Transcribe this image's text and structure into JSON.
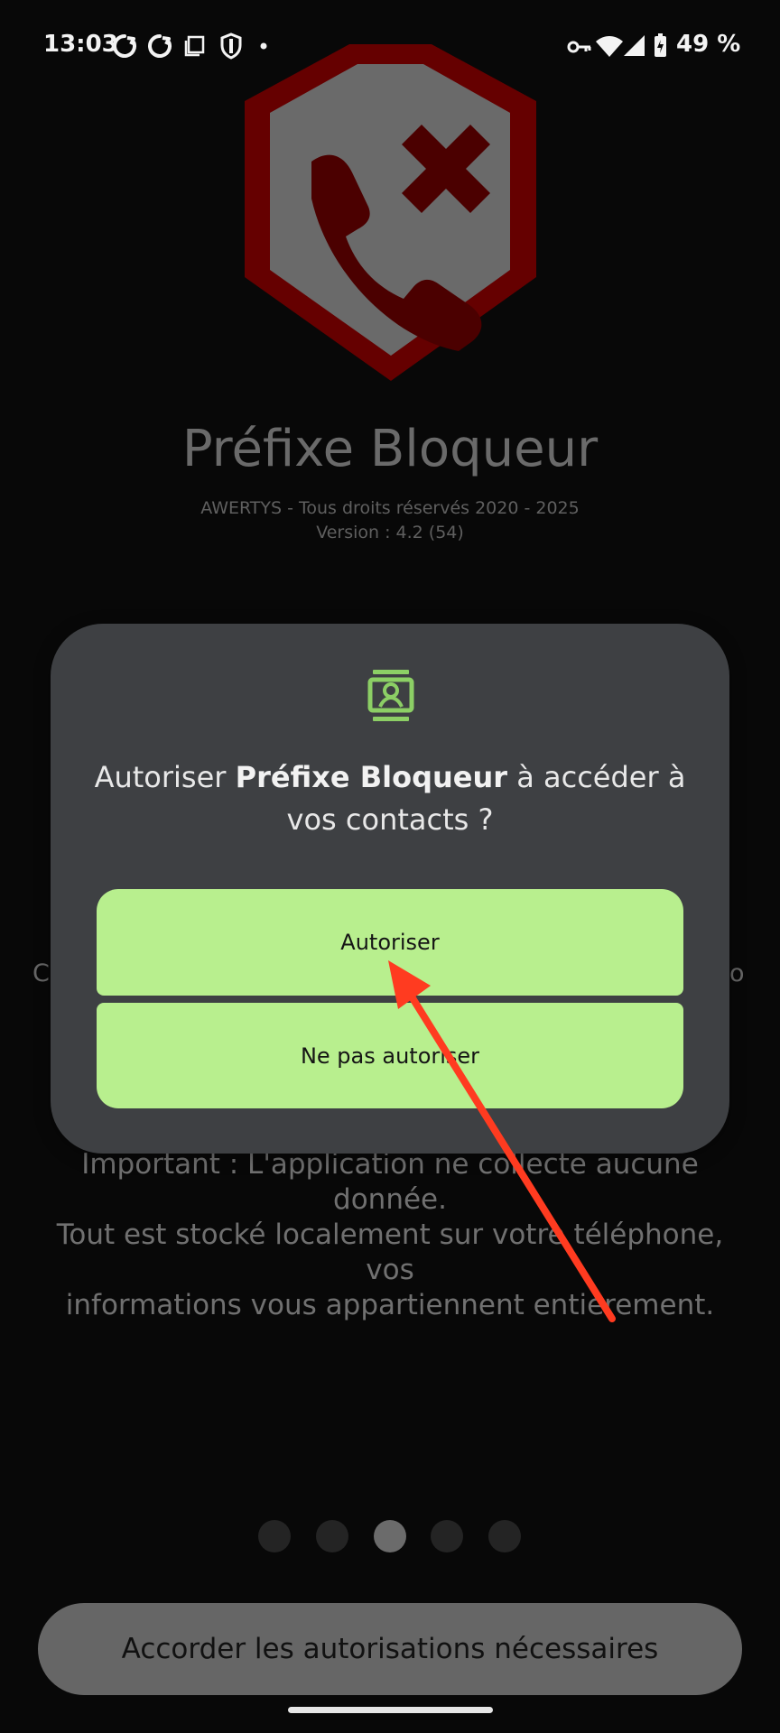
{
  "status_bar": {
    "time": "13:03",
    "left_icons": [
      "sync-icon",
      "sync-icon",
      "screen-icon",
      "shield-icon",
      "dot-icon"
    ],
    "right_icons": [
      "vpn-key-icon",
      "wifi-icon",
      "cell-signal-icon",
      "battery-icon"
    ],
    "battery": "49 %"
  },
  "app": {
    "logo_icon": "blocked-call-shield-icon",
    "title": "Préfixe Bloqueur",
    "copyright": "AWERTYS - Tous droits réservés 2020 - 2025",
    "version": "Version : 4.2 (54)",
    "hidden_text_left": "C",
    "hidden_text_right": "o",
    "important_lines": [
      "Important : L'application ne collecte aucune donnée.",
      "Tout est stocké localement sur votre téléphone, vos",
      "informations vous appartiennent entièrement."
    ],
    "page_indicator": {
      "total": 5,
      "active_index": 2
    },
    "grant_button_label": "Accorder les autorisations nécessaires"
  },
  "dialog": {
    "icon": "contacts-icon",
    "message_prefix": "Autoriser ",
    "app_name": "Préfixe Bloqueur",
    "message_suffix": " à accéder à",
    "message_line_two": "vos contacts ?",
    "allow_label": "Autoriser",
    "deny_label": "Ne pas autoriser"
  },
  "annotation": {
    "color": "#ff3b20",
    "icon": "red-arrow-icon"
  },
  "colors": {
    "background": "#080808",
    "dialog": "#3e4043",
    "dialog_button": "#b8ef8e",
    "logo_red": "#650000",
    "logo_shield": "#6a6a6a"
  }
}
